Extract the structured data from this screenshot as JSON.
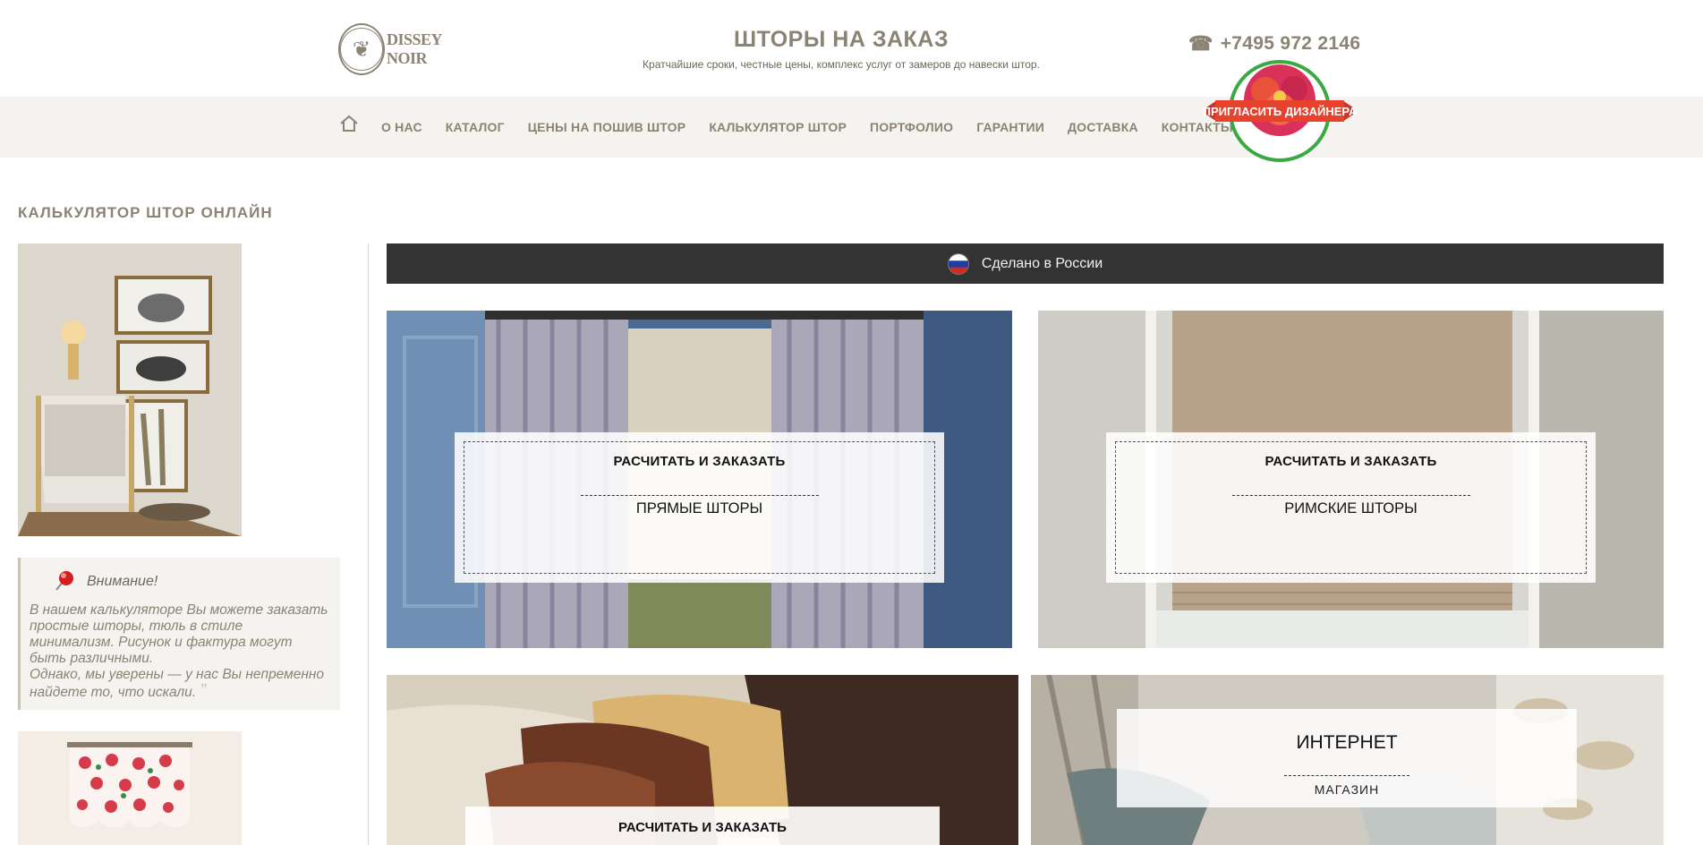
{
  "header": {
    "logo_text": "DISSEY NOIR",
    "title": "ШТОРЫ НА ЗАКАЗ",
    "subtitle": "Кратчайшие сроки, честные цены, комплекс услуг от замеров до навески штор.",
    "phone": "+7495 972 2146"
  },
  "nav": {
    "items": [
      "О НАС",
      "КАТАЛОГ",
      "ЦЕНЫ НА ПОШИВ ШТОР",
      "КАЛЬКУЛЯТОР ШТОР",
      "ПОРТФОЛИО",
      "ГАРАНТИИ",
      "ДОСТАВКА",
      "КОНТАКТЫ"
    ],
    "designer_badge": "ПРИГЛАСИТЬ ДИЗАЙНЕРА"
  },
  "sidebar": {
    "title": "КАЛЬКУЛЯТОР ШТОР ОНЛАЙН",
    "attention_title": "Внимание!",
    "attention_body_1": "В нашем калькуляторе Вы можете заказать простые шторы, тюль в стиле минимализм. Рисунок и фактура могут быть различными.",
    "attention_body_2": "Однако, мы уверены — у нас Вы непременно найдете то, что искали."
  },
  "main": {
    "banner": "Сделано в России",
    "tiles": [
      {
        "cta": "РАСЧИТАТЬ И ЗАКАЗАТЬ",
        "name": "ПРЯМЫЕ ШТОРЫ"
      },
      {
        "cta": "РАСЧИТАТЬ И ЗАКАЗАТЬ",
        "name": "РИМСКИЕ ШТОРЫ"
      },
      {
        "cta": "РАСЧИТАТЬ И ЗАКАЗАТЬ"
      }
    ],
    "shop": {
      "big": "ИНТЕРНЕТ",
      "small": "МАГАЗИН"
    }
  },
  "colors": {
    "brand": "#8b8373",
    "nav_bg": "#f4f3ef",
    "banner_bg": "#333333",
    "badge_red": "#e8412c",
    "badge_green": "#3aa843"
  }
}
